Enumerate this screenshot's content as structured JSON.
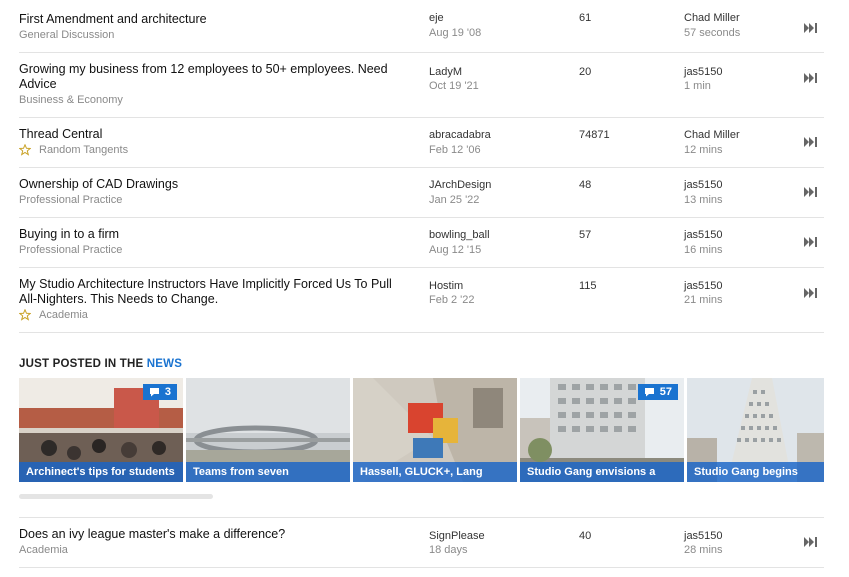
{
  "threads": [
    {
      "title": "First Amendment and architecture",
      "category": "General Discussion",
      "starred": false,
      "author": "eje",
      "date": "Aug 19 '08",
      "count": "61",
      "last_user": "Chad Miller",
      "last_time": "57 seconds"
    },
    {
      "title": "Growing my business from 12 employees to 50+ employees. Need Advice",
      "category": "Business & Economy",
      "starred": false,
      "author": "LadyM",
      "date": "Oct 19 '21",
      "count": "20",
      "last_user": "jas5150",
      "last_time": "1 min"
    },
    {
      "title": "Thread Central",
      "category": "Random Tangents",
      "starred": true,
      "author": "abracadabra",
      "date": "Feb 12 '06",
      "count": "74871",
      "last_user": "Chad Miller",
      "last_time": "12 mins"
    },
    {
      "title": "Ownership of CAD Drawings",
      "category": "Professional Practice",
      "starred": false,
      "author": "JArchDesign",
      "date": "Jan 25 '22",
      "count": "48",
      "last_user": "jas5150",
      "last_time": "13 mins"
    },
    {
      "title": "Buying in to a firm",
      "category": "Professional Practice",
      "starred": false,
      "author": "bowling_ball",
      "date": "Aug 12 '15",
      "count": "57",
      "last_user": "jas5150",
      "last_time": "16 mins"
    },
    {
      "title": "My Studio Architecture Instructors Have Implicitly Forced Us To Pull All-Nighters. This Needs to Change.",
      "category": "Academia",
      "starred": true,
      "author": "Hostim",
      "date": "Feb 2 '22",
      "count": "115",
      "last_user": "jas5150",
      "last_time": "21 mins"
    }
  ],
  "news": {
    "heading_prefix": "JUST POSTED IN THE",
    "heading_highlight": "NEWS",
    "cards": [
      {
        "caption": "Archinect's tips for students",
        "comments": "3"
      },
      {
        "caption": "Teams from seven",
        "comments": null
      },
      {
        "caption": "Hassell, GLUCK+, Lang",
        "comments": null
      },
      {
        "caption": "Studio Gang envisions a",
        "comments": "57"
      },
      {
        "caption": "Studio Gang begins",
        "comments": null
      }
    ]
  },
  "bottom_thread": {
    "title": "Does an ivy league master's make a difference?",
    "category": "Academia",
    "author": "SignPlease",
    "date": "18 days",
    "count": "40",
    "last_user": "jas5150",
    "last_time": "28 mins"
  },
  "colors": {
    "accent": "#1a73d0",
    "caption_bg": "rgba(25,100,200,0.82)"
  },
  "icons": {
    "jump": "jump-to-end-icon",
    "star": "star-outline-icon",
    "comment": "comment-bubble-icon"
  }
}
